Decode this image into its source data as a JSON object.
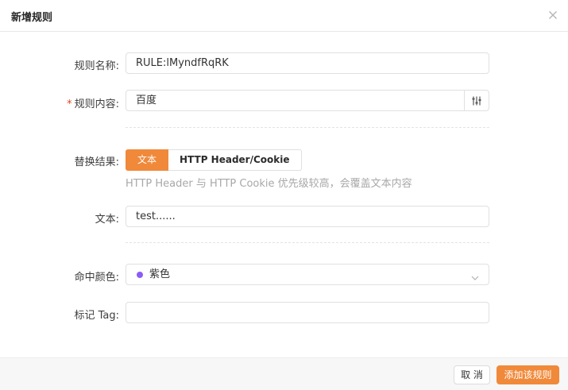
{
  "dialog": {
    "title": "新增规则",
    "close_icon": "close-icon"
  },
  "form": {
    "rule_name": {
      "label": "规则名称:",
      "value": "RULE:lMyndfRqRK"
    },
    "rule_content": {
      "required_mark": "*",
      "label": "规则内容:",
      "value": "百度",
      "addon_icon": "filter-sliders-icon"
    },
    "replace_result": {
      "label": "替换结果:",
      "options": [
        "文本",
        "HTTP Header/Cookie"
      ],
      "selected": "文本",
      "hint": "HTTP Header 与 HTTP Cookie 优先级较高，会覆盖文本内容"
    },
    "text": {
      "label": "文本:",
      "value": "test......"
    },
    "hit_color": {
      "label": "命中颜色:",
      "value": "紫色",
      "dot_color": "#8b5cf6",
      "icon": "chevron-down-icon"
    },
    "tag": {
      "label": "标记 Tag:",
      "value": ""
    }
  },
  "footer": {
    "cancel_label": "取 消",
    "submit_label": "添加该规则"
  },
  "colors": {
    "accent": "#f0893a",
    "required": "#e0452d"
  }
}
